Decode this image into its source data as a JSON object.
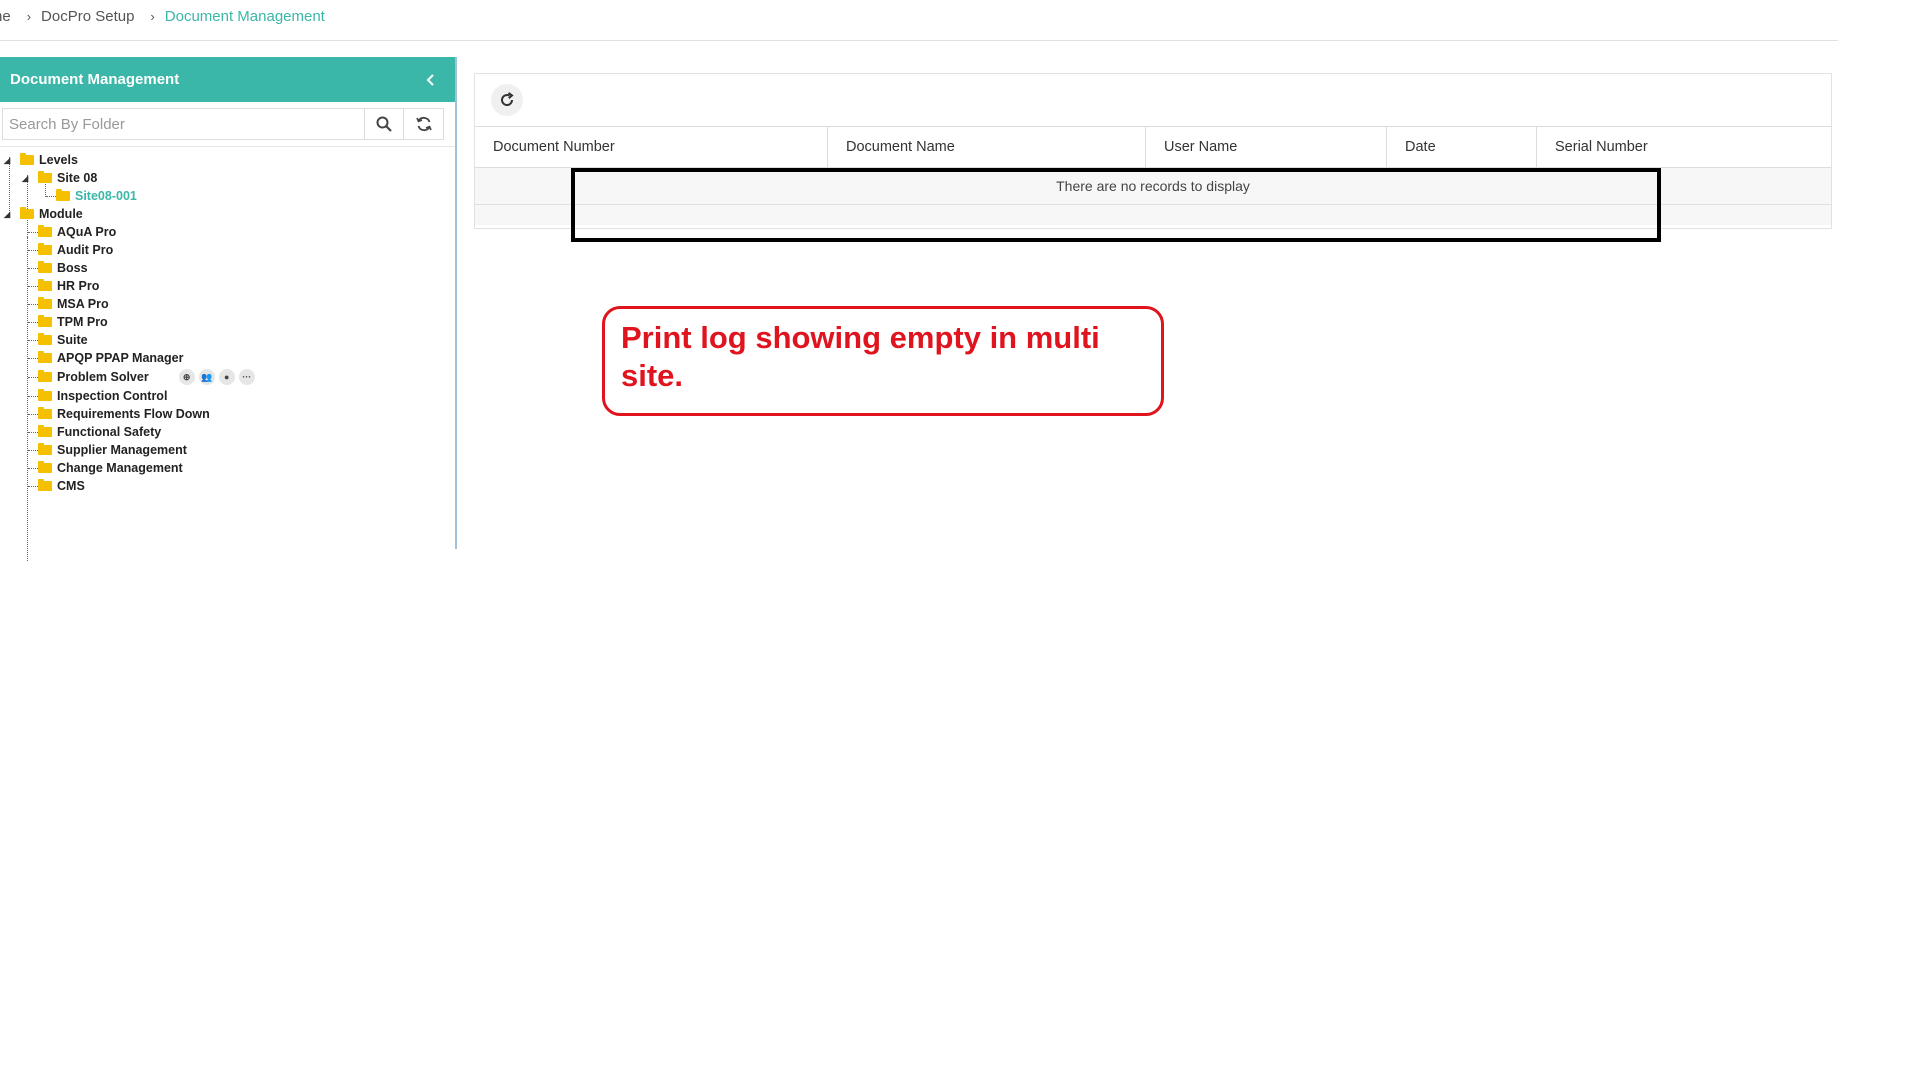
{
  "breadcrumb": {
    "items": [
      "ne",
      "DocPro Setup",
      "Document Management"
    ],
    "separator": "›"
  },
  "left_panel": {
    "title": "Document Management",
    "search_placeholder": "Search By Folder",
    "icons": {
      "collapse": "chevron-left-icon",
      "search": "search-icon",
      "refresh": "refresh-icon"
    }
  },
  "tree": {
    "levels_label": "Levels",
    "site_label": "Site 08",
    "subsite_label": "Site08-001",
    "module_label": "Module",
    "modules": [
      "AQuA Pro",
      "Audit Pro",
      "Boss",
      "HR Pro",
      "MSA Pro",
      "TPM Pro",
      "Suite",
      "APQP PPAP Manager",
      "Problem Solver",
      "Inspection Control",
      "Requirements Flow Down",
      "Functional Safety",
      "Supplier Management",
      "Change Management",
      "CMS"
    ],
    "problem_solver_actions": [
      "globe-icon",
      "group-icon",
      "user-icon",
      "more-icon"
    ]
  },
  "grid": {
    "columns": [
      "Document Number",
      "Document Name",
      "User Name",
      "Date",
      "Serial Number"
    ],
    "empty_message": "There are no records to display",
    "refresh_icon": "refresh-icon"
  },
  "annotation": {
    "callout_text": "Print log showing empty in multi site.",
    "callout_color": "#e0141e",
    "highlight_color": "#000000"
  },
  "colors": {
    "accent": "#3ab7a8",
    "folder": "#f5c000"
  }
}
